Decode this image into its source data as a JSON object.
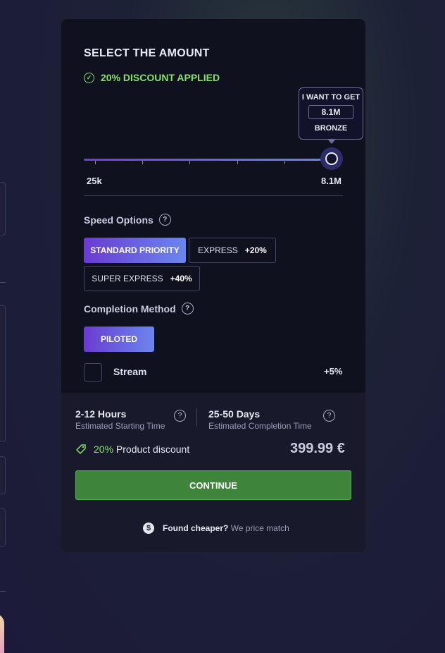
{
  "amount": {
    "title": "SELECT THE AMOUNT",
    "discount_text": "20% DISCOUNT APPLIED",
    "tooltip_heading": "I WANT TO GET",
    "tooltip_value": "8.1M",
    "tooltip_rank": "BRONZE",
    "slider_min_label": "25k",
    "slider_max_label": "8.1M",
    "slider_fill_percent": 96
  },
  "speed": {
    "label": "Speed Options",
    "options": [
      {
        "label": "STANDARD PRIORITY",
        "extra": "",
        "selected": true
      },
      {
        "label": "EXPRESS",
        "extra": "+20%",
        "selected": false
      },
      {
        "label": "SUPER EXPRESS",
        "extra": "+40%",
        "selected": false
      }
    ]
  },
  "completion": {
    "label": "Completion Method",
    "method": "PILOTED",
    "stream_label": "Stream",
    "stream_extra": "+5%",
    "stream_checked": false
  },
  "summary": {
    "start_time": "2-12 Hours",
    "start_caption": "Estimated Starting Time",
    "completion_time": "25-50 Days",
    "completion_caption": "Estimated Completion Time",
    "discount_percent": "20%",
    "discount_label": "Product discount",
    "price": "399.99 €",
    "continue_label": "CONTINUE",
    "match_bold": "Found cheaper?",
    "match_text": "We price match"
  },
  "colors": {
    "accent_gradient_start": "#6a3bd2",
    "accent_gradient_end": "#6b86ee",
    "success_green": "#88e06c",
    "button_green": "#3f843b"
  },
  "icons": [
    "check-circle-icon",
    "help-icon",
    "tag-icon",
    "dollar-icon"
  ]
}
